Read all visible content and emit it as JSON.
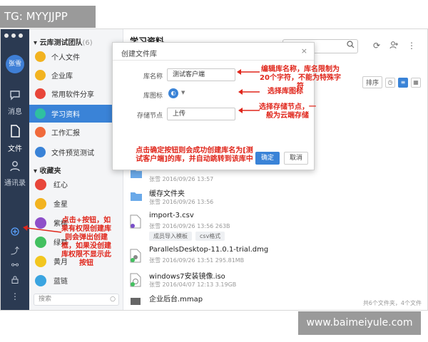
{
  "watermarks": {
    "top": "TG: MYYJJPP",
    "bottom": "www.baimeiyule.com"
  },
  "nav": {
    "avatar": "张雪",
    "messages_label": "消息",
    "files_label": "文件",
    "contacts_label": "通讯录"
  },
  "libcol": {
    "team_title": "云库测试团队",
    "team_count": "(6)",
    "items": [
      {
        "label": "个人文件",
        "color": "#f2b320"
      },
      {
        "label": "企业库",
        "color": "#f2b320"
      },
      {
        "label": "常用软件分享",
        "color": "#e8463a"
      },
      {
        "label": "学习资料",
        "color": "#2fc0a0"
      },
      {
        "label": "工作汇报",
        "color": "#f06a3b"
      },
      {
        "label": "文件预览测试",
        "color": "#3a83d7"
      }
    ],
    "fav_title": "收藏夹",
    "favorites": [
      {
        "label": "红心",
        "color": "#e8463a"
      },
      {
        "label": "金星",
        "color": "#f2b320"
      },
      {
        "label": "紫楼",
        "color": "#8e4fc9"
      },
      {
        "label": "绿草",
        "color": "#43c060"
      },
      {
        "label": "黄月",
        "color": "#f2c61f"
      },
      {
        "label": "蓝链",
        "color": "#3aa4e0"
      }
    ],
    "search_placeholder": "搜索"
  },
  "main": {
    "title": "学习资料",
    "sort_label": "排序",
    "files": [
      {
        "name": "",
        "meta": "张雪    2016/09/26 13:57"
      },
      {
        "name": "缓存文件夹",
        "meta": "张雪    2016/09/26 13:56"
      },
      {
        "name": "import-3.csv",
        "meta": "张雪    2016/09/26 13:56    263B",
        "tags": [
          "成员导入模板",
          "csv格式"
        ]
      },
      {
        "name": "ParallelsDesktop-11.0.1-trial.dmg",
        "meta": "张雪    2016/09/26 13:51    295.81MB"
      },
      {
        "name": "windows7安装镜像.iso",
        "meta": "张雪    2016/04/07 12:13    3.19GB"
      },
      {
        "name": "企业后台.mmap",
        "meta": ""
      }
    ],
    "footer_count": "共6个文件夹，4个文件"
  },
  "dialog": {
    "title": "创建文件库",
    "name_label": "库名称",
    "name_value": "测试客户端",
    "icon_label": "库图标",
    "storage_label": "存储节点",
    "storage_value": "上传",
    "ok": "确定",
    "cancel": "取消"
  },
  "annotations": {
    "name": "编辑库名称，库名限制为20个字符，不能为特殊字符",
    "icon": "选择库图标",
    "storage": "选择存储节点，一般为云端存储",
    "confirm": "点击确定按钮则会成功创建库名为[测试客户端]的库，并自动跳转到该库中",
    "plus": "点击+按钮，如果有权限创建库则会弹出创建框，如果没创建库权限不显示此按钮"
  }
}
